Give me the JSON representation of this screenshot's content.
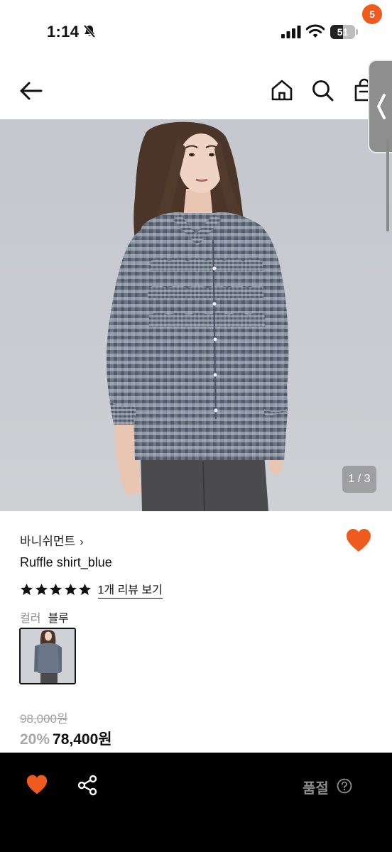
{
  "status_bar": {
    "time": "1:14",
    "battery_level": "51"
  },
  "header": {
    "cart_badge": "5"
  },
  "gallery": {
    "counter": "1 / 3"
  },
  "product": {
    "brand": "바니쉬먼트",
    "brand_chevron": "›",
    "name": "Ruffle shirt_blue",
    "rating_stars": 5,
    "review_link": "1개 리뷰 보기",
    "color_label": "컬러",
    "color_value": "블루",
    "original_price": "98,000원",
    "discount": "20%",
    "sale_price": "78,400원"
  },
  "bottom_bar": {
    "status_label": "품절"
  },
  "colors": {
    "accent": "#ef5a1e",
    "bottom_bar_bg": "#000000",
    "muted": "#8c8c8c"
  },
  "icons": [
    "bell-off-icon",
    "signal-icon",
    "wifi-icon",
    "battery-icon",
    "back-arrow-icon",
    "home-icon",
    "search-icon",
    "cart-icon",
    "chevron-left-icon",
    "heart-icon",
    "star-icon",
    "share-icon",
    "help-icon"
  ]
}
